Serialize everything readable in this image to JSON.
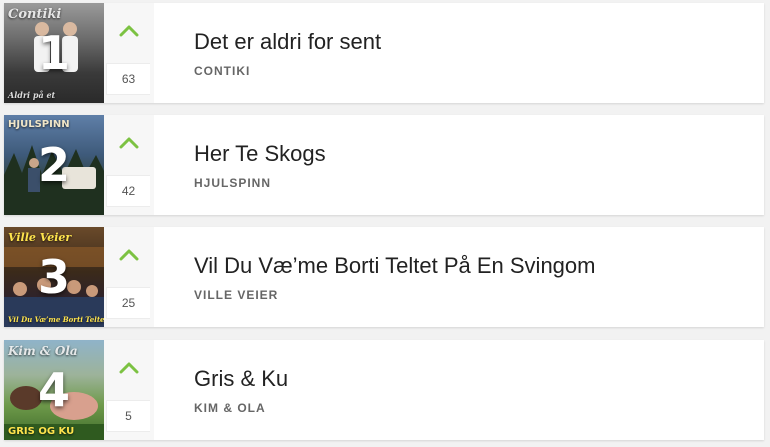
{
  "colors": {
    "accent": "#7cc242",
    "title": "#222222",
    "artist": "#666666"
  },
  "icons": {
    "upvote": "chevron-up-icon"
  },
  "entries": [
    {
      "rank": "1",
      "votes": "63",
      "title": "Det er aldri for sent",
      "artist": "CONTIKI",
      "cover_text": "Contiki",
      "cover_subtext": "Aldri på et"
    },
    {
      "rank": "2",
      "votes": "42",
      "title": "Her Te Skogs",
      "artist": "HJULSPINN",
      "cover_text": "HJULSPINN",
      "cover_subtext": ""
    },
    {
      "rank": "3",
      "votes": "25",
      "title": "Vil Du Væ’me Borti Teltet På En Svingom",
      "artist": "VILLE VEIER",
      "cover_text": "Ville Veier",
      "cover_subtext": "Vil Du Væ’me Borti Teltet"
    },
    {
      "rank": "4",
      "votes": "5",
      "title": "Gris & Ku",
      "artist": "KIM & OLA",
      "cover_text": "Kim & Ola",
      "cover_subtext": "GRIS OG KU"
    }
  ]
}
